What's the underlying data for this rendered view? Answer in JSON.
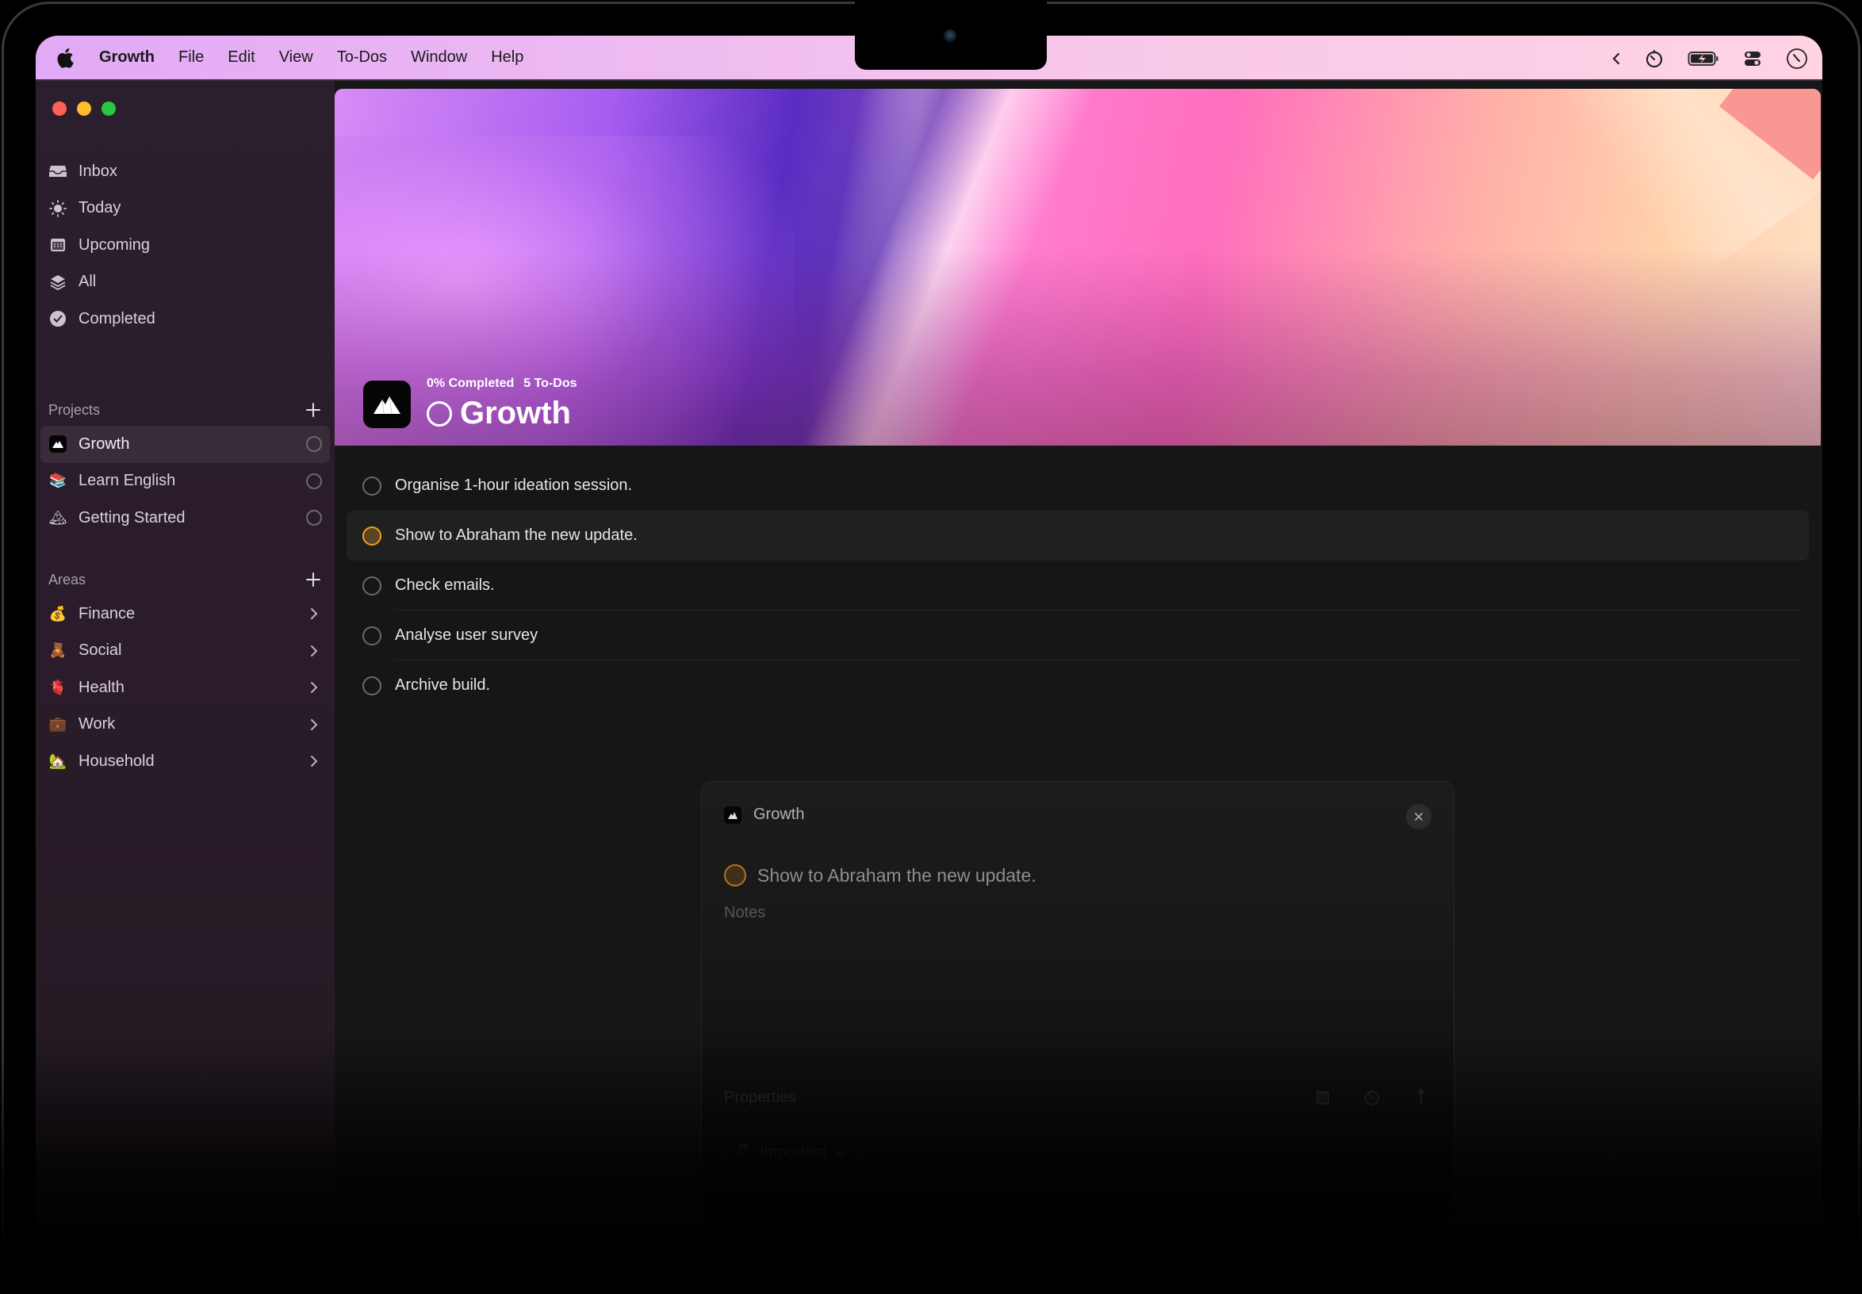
{
  "menubar": {
    "app_name": "Growth",
    "items": [
      "File",
      "Edit",
      "View",
      "To-Dos",
      "Window",
      "Help"
    ],
    "status_icons": [
      "chevron-left-icon",
      "timer-icon",
      "battery-charging-icon",
      "control-center-icon",
      "clock-icon"
    ]
  },
  "sidebar": {
    "nav": [
      {
        "label": "Inbox",
        "icon": "inbox-icon"
      },
      {
        "label": "Today",
        "icon": "sun-icon"
      },
      {
        "label": "Upcoming",
        "icon": "calendar-icon"
      },
      {
        "label": "All",
        "icon": "layers-icon"
      },
      {
        "label": "Completed",
        "icon": "checkmark-circle-icon"
      }
    ],
    "projects_header": "Projects",
    "projects": [
      {
        "label": "Growth",
        "icon": "mountain-icon",
        "active": true
      },
      {
        "label": "Learn English",
        "icon": "books-emoji",
        "emoji": "📚"
      },
      {
        "label": "Getting Started",
        "icon": "mountain-emoji",
        "emoji": "🏔"
      }
    ],
    "areas_header": "Areas",
    "areas": [
      {
        "label": "Finance",
        "emoji": "💰"
      },
      {
        "label": "Social",
        "emoji": "🧸"
      },
      {
        "label": "Health",
        "emoji": "🫀"
      },
      {
        "label": "Work",
        "emoji": "💼"
      },
      {
        "label": "Household",
        "emoji": "🏡"
      }
    ]
  },
  "project": {
    "title": "Growth",
    "completed": "0% Completed",
    "count": "5 To-Dos",
    "progress_percent": 0
  },
  "todos": [
    {
      "title": "Organise 1-hour ideation session.",
      "selected": false
    },
    {
      "title": "Show to Abraham the new update.",
      "selected": true
    },
    {
      "title": "Check emails.",
      "selected": false
    },
    {
      "title": "Analyse user survey",
      "selected": false
    },
    {
      "title": "Archive build.",
      "selected": false
    }
  ],
  "detail": {
    "project": "Growth",
    "task_title": "Show to Abraham the new update.",
    "notes_placeholder": "Notes",
    "properties_label": "Properties",
    "tag": "Important"
  },
  "colors": {
    "accent_orange": "#f0a020",
    "sidebar_bg": "#2a1d2b",
    "main_bg": "#161616"
  }
}
